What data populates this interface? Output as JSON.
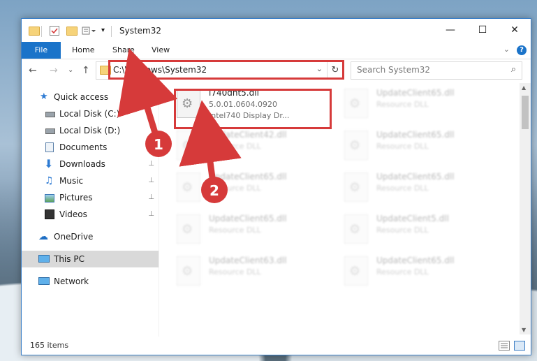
{
  "window": {
    "title": "System32",
    "controls": {
      "minimize": "—",
      "maximize": "☐",
      "close": "✕"
    }
  },
  "ribbon": {
    "tabs": [
      "File",
      "Home",
      "Share",
      "View"
    ],
    "collapse_glyph": "⌄",
    "help_glyph": "?"
  },
  "nav": {
    "address": "C:\\Windows\\System32",
    "search_placeholder": "Search System32",
    "back_glyph": "←",
    "forward_glyph": "→",
    "recent_glyph": "⌄",
    "up_glyph": "↑",
    "refresh_glyph": "↻",
    "search_glyph": "⌕",
    "dropdown_glyph": "⌄"
  },
  "sidebar": {
    "items": [
      {
        "label": "Quick access",
        "icon": "star-icon",
        "pinned": false
      },
      {
        "label": "Local Disk (C:)",
        "icon": "drive-icon",
        "pinned": false
      },
      {
        "label": "Local Disk (D:)",
        "icon": "drive-icon",
        "pinned": false
      },
      {
        "label": "Documents",
        "icon": "document-icon",
        "pinned": true
      },
      {
        "label": "Downloads",
        "icon": "download-icon",
        "pinned": true
      },
      {
        "label": "Music",
        "icon": "music-icon",
        "pinned": true
      },
      {
        "label": "Pictures",
        "icon": "pictures-icon",
        "pinned": true
      },
      {
        "label": "Videos",
        "icon": "video-icon",
        "pinned": true
      },
      {
        "label": "OneDrive",
        "icon": "cloud-icon",
        "pinned": false
      },
      {
        "label": "This PC",
        "icon": "computer-icon",
        "pinned": false,
        "selected": true
      },
      {
        "label": "Network",
        "icon": "network-icon",
        "pinned": false
      }
    ],
    "pin_glyph": "📌"
  },
  "files": [
    {
      "name": "i740dnt5.dll",
      "line2": "5.0.01.0604.0920",
      "line3": "Intel740 Display Dr...",
      "highlighted": true
    },
    {
      "name": "UpdateClient65.dll",
      "line2": "Resource DLL",
      "line3": "",
      "faded": true
    },
    {
      "name": "UpdateClient42.dll",
      "line2": "Resource DLL",
      "line3": "",
      "faded": true
    },
    {
      "name": "UpdateClient65.dll",
      "line2": "Resource DLL",
      "line3": "",
      "faded": true
    },
    {
      "name": "UpdateClient65.dll",
      "line2": "Resource DLL",
      "line3": "",
      "faded": true
    },
    {
      "name": "UpdateClient65.dll",
      "line2": "Resource DLL",
      "line3": "",
      "faded": true
    },
    {
      "name": "UpdateClient65.dll",
      "line2": "Resource DLL",
      "line3": "",
      "faded": true
    },
    {
      "name": "UpdateClient5.dll",
      "line2": "Resource DLL",
      "line3": "",
      "faded": true
    },
    {
      "name": "UpdateClient63.dll",
      "line2": "Resource DLL",
      "line3": "",
      "faded": true
    },
    {
      "name": "UpdateClient65.dll",
      "line2": "Resource DLL",
      "line3": "",
      "faded": true
    }
  ],
  "status": {
    "item_count": "165 items"
  },
  "annotations": {
    "step1": "1",
    "step2": "2",
    "color": "#d63a3a"
  }
}
